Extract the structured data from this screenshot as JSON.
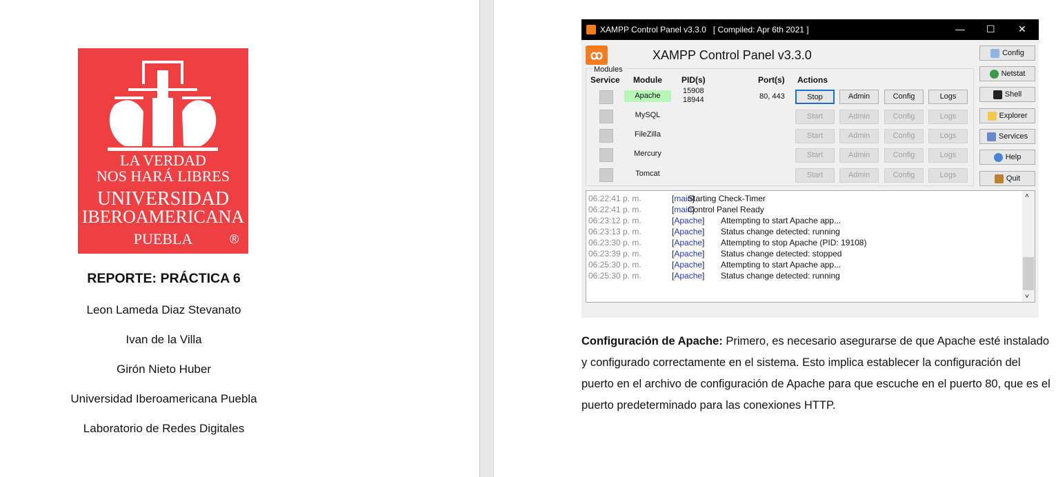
{
  "left_page": {
    "logo": {
      "motto_1": "LA VERDAD",
      "motto_2": "NOS HARÁ LIBRES",
      "name_1": "UNIVERSIDAD",
      "name_2": "IBEROAMERICANA",
      "campus": "PUEBLA",
      "registered": "®",
      "color": "#ee3f43"
    },
    "title": "REPORTE: PRÁCTICA 6",
    "lines": [
      "Leon Lameda Diaz Stevanato",
      "Ivan de la Villa",
      "Girón Nieto Huber",
      "Universidad Iberoamericana Puebla",
      "Laboratorio de Redes Digitales"
    ]
  },
  "xampp": {
    "window_title": "XAMPP Control Panel v3.3.0   [ Compiled: Apr 6th 2021 ]",
    "panel_title": "XAMPP Control Panel v3.3.0",
    "group_label": "Modules",
    "headers": {
      "service": "Service",
      "module": "Module",
      "pids": "PID(s)",
      "ports": "Port(s)",
      "actions": "Actions"
    },
    "modules": [
      {
        "name": "Apache",
        "pids": [
          "15908",
          "18944"
        ],
        "ports": "80, 443",
        "action": "Stop",
        "running": true
      },
      {
        "name": "MySQL",
        "pids": [],
        "ports": "",
        "action": "Start",
        "running": false
      },
      {
        "name": "FileZilla",
        "pids": [],
        "ports": "",
        "action": "Start",
        "running": false
      },
      {
        "name": "Mercury",
        "pids": [],
        "ports": "",
        "action": "Start",
        "running": false
      },
      {
        "name": "Tomcat",
        "pids": [],
        "ports": "",
        "action": "Start",
        "running": false
      }
    ],
    "row_buttons": {
      "admin": "Admin",
      "config": "Config",
      "logs": "Logs"
    },
    "side_buttons": [
      "Config",
      "Netstat",
      "Shell",
      "Explorer",
      "Services",
      "Help",
      "Quit"
    ],
    "log": [
      {
        "time": "06:22:41 p. m.",
        "source": "main",
        "message": "Starting Check-Timer"
      },
      {
        "time": "06:22:41 p. m.",
        "source": "main",
        "message": "Control Panel Ready"
      },
      {
        "time": "06:23:12 p. m.",
        "source": "Apache",
        "message": "Attempting to start Apache app..."
      },
      {
        "time": "06:23:13 p. m.",
        "source": "Apache",
        "message": "Status change detected: running"
      },
      {
        "time": "06:23:30 p. m.",
        "source": "Apache",
        "message": "Attempting to stop Apache (PID: 19108)"
      },
      {
        "time": "06:23:39 p. m.",
        "source": "Apache",
        "message": "Status change detected: stopped"
      },
      {
        "time": "06:25:30 p. m.",
        "source": "Apache",
        "message": "Attempting to start Apache app..."
      },
      {
        "time": "06:25:30 p. m.",
        "source": "Apache",
        "message": "Status change detected: running"
      }
    ]
  },
  "caption": {
    "bold": "Configuración de Apache:",
    "text": " Primero, es necesario asegurarse de que Apache esté instalado y configurado correctamente en el sistema. Esto implica establecer la configuración del puerto en el archivo de configuración de Apache para que escuche en el puerto 80, que es el puerto predeterminado para las conexiones HTTP."
  }
}
